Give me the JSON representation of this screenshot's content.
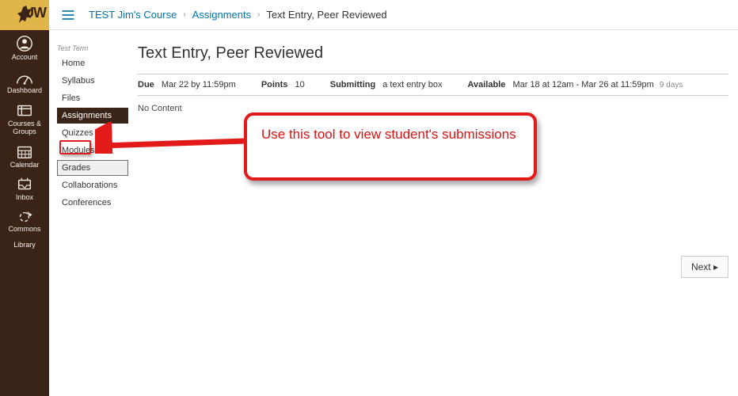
{
  "logo_text": "UW",
  "rail": [
    {
      "key": "account",
      "label": "Account"
    },
    {
      "key": "dashboard",
      "label": "Dashboard"
    },
    {
      "key": "courses",
      "label": "Courses & Groups"
    },
    {
      "key": "calendar",
      "label": "Calendar"
    },
    {
      "key": "inbox",
      "label": "Inbox"
    },
    {
      "key": "commons",
      "label": "Commons"
    },
    {
      "key": "library",
      "label": "Library"
    }
  ],
  "breadcrumbs": {
    "course": "TEST Jim's Course",
    "section": "Assignments",
    "page": "Text Entry, Peer Reviewed"
  },
  "term_label": "Test Term",
  "course_nav": [
    {
      "label": "Home"
    },
    {
      "label": "Syllabus"
    },
    {
      "label": "Files"
    },
    {
      "label": "Assignments",
      "active": true
    },
    {
      "label": "Quizzes"
    },
    {
      "label": "Modules"
    },
    {
      "label": "Grades",
      "highlighted": true
    },
    {
      "label": "Collaborations"
    },
    {
      "label": "Conferences"
    }
  ],
  "page_title": "Text Entry, Peer Reviewed",
  "meta": {
    "due_label": "Due",
    "due_value": "Mar 22 by 11:59pm",
    "points_label": "Points",
    "points_value": "10",
    "submitting_label": "Submitting",
    "submitting_value": "a text entry box",
    "available_label": "Available",
    "available_value": "Mar 18 at 12am - Mar 26 at 11:59pm",
    "available_sub": "9 days"
  },
  "body_text": "No Content",
  "next_label": "Next ▸",
  "callout_text": "Use this tool to view student's submissions"
}
